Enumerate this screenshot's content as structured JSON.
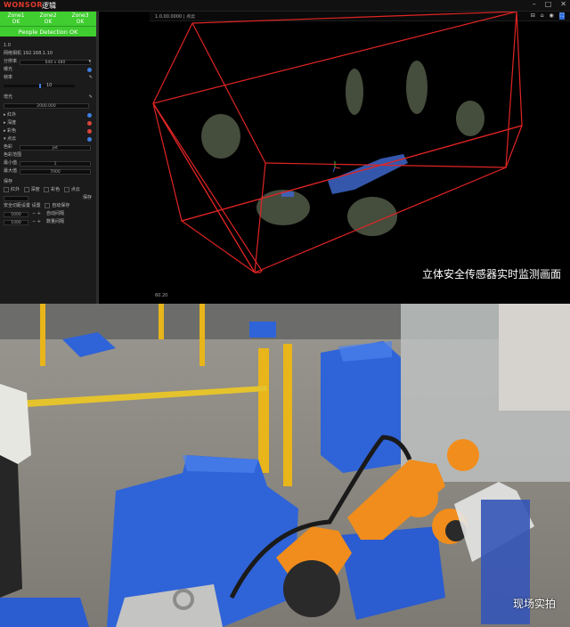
{
  "app": {
    "logo": "WONSOR",
    "logo_cn": "逻辑",
    "window_controls": [
      "–",
      "□",
      "✕"
    ]
  },
  "zones": [
    {
      "name": "Zone1",
      "status": "OK"
    },
    {
      "name": "Zone2",
      "status": "OK"
    },
    {
      "name": "Zone3",
      "status": "OK"
    }
  ],
  "people_detection": "People Detection OK",
  "sidebar": {
    "version": "1.0",
    "ip_label": "网络相机",
    "ip": "192.168.1.10",
    "resolution_label": "分辨率",
    "resolution": "640 x 480",
    "item_a": "曝光",
    "item_b": "帧率",
    "slider_value": "10",
    "gain_label": "增光",
    "gain_value": "2000.000",
    "rows": [
      "红外",
      "深度",
      "彩色",
      "点云"
    ],
    "color_label": "色彩",
    "color_value": "Jet",
    "range_header": "色彩范围",
    "min_label": "最小值",
    "min_value": "1",
    "max_label": "最大值",
    "max_value": "7000",
    "save_header": "保存",
    "save_options": [
      "红外",
      "深度",
      "彩色",
      "点云"
    ],
    "save_button": "保存",
    "auto_label": "安全切距设置",
    "auto_reset": "设置",
    "auto_check": "自动保存",
    "value_1": "5000",
    "value_1_label": "自动间隔",
    "value_2": "1000",
    "value_2_label": "数量间隔"
  },
  "viewer": {
    "title": "1.0.00.0000 | 点云",
    "icons": [
      "⊟",
      "⌂",
      "◉",
      "⛶"
    ],
    "fps": "60.20"
  },
  "captions": {
    "top": "立体安全传感器实时监测画面",
    "bottom": "现场实拍"
  }
}
